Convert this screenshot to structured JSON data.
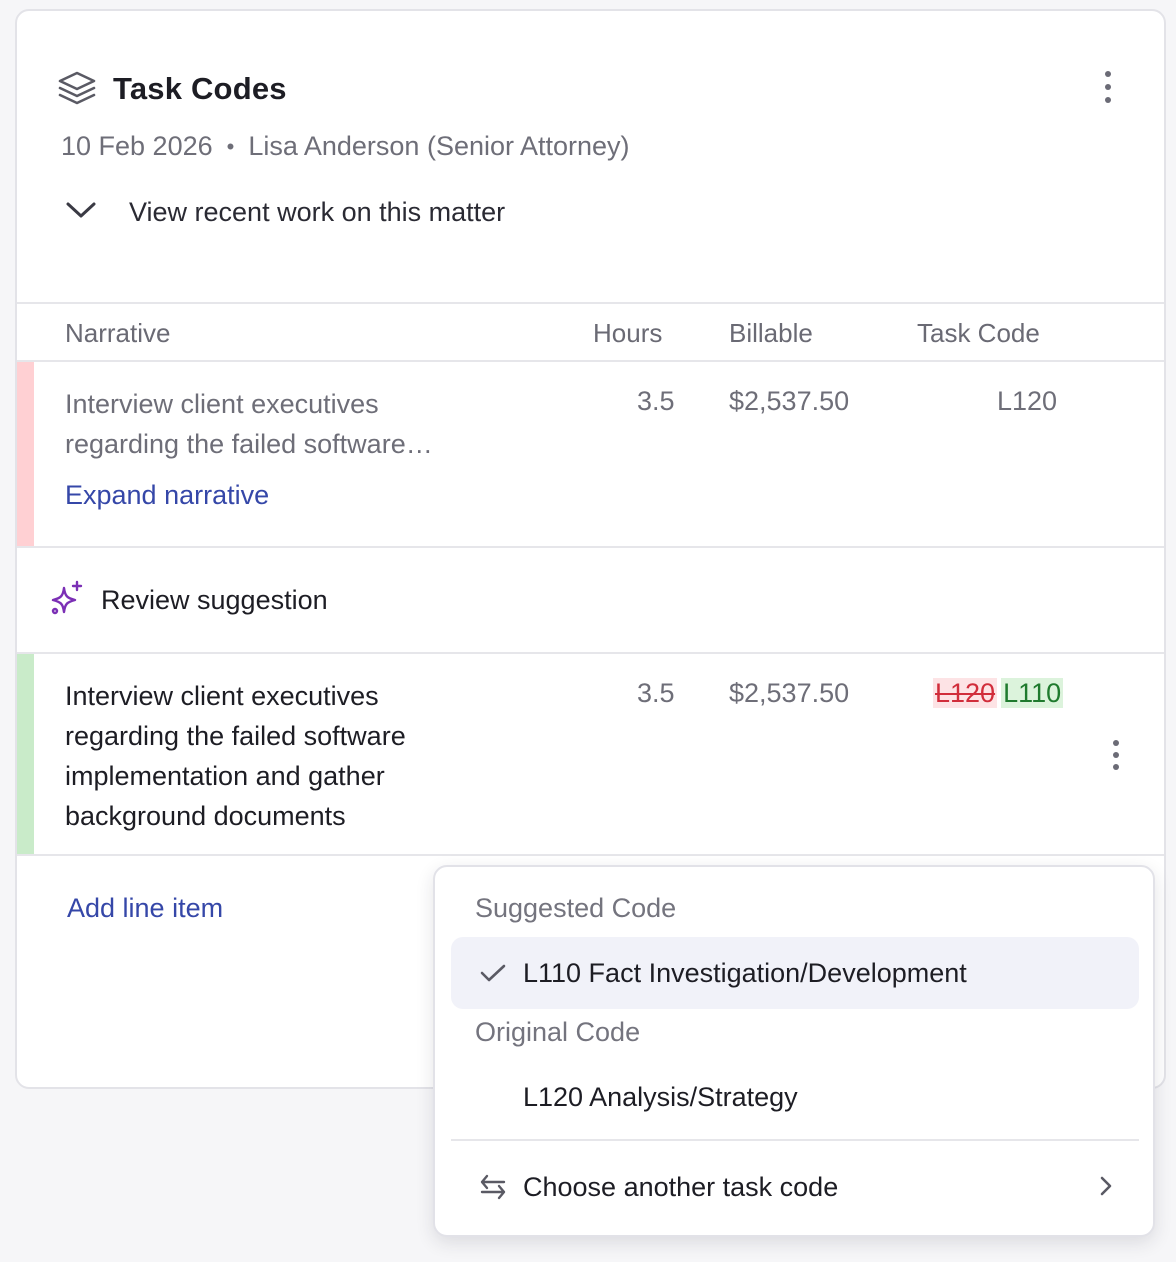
{
  "card": {
    "title": "Task Codes",
    "title_icon": "layers-icon",
    "date": "10 Feb 2026",
    "separator": "•",
    "user": "Lisa Anderson (Senior Attorney)",
    "recent_toggle": "View recent work on this matter"
  },
  "table": {
    "headers": {
      "narrative": "Narrative",
      "hours": "Hours",
      "billable": "Billable",
      "task_code": "Task Code"
    },
    "original_row": {
      "narrative": "Interview client executives regarding the failed software…",
      "hours": "3.5",
      "billable": "$2,537.50",
      "task_code": "L120",
      "expand_link": "Expand narrative",
      "accent_color": "#ffd0d3"
    },
    "review": {
      "label": "Review suggestion",
      "icon": "sparkle-icon",
      "icon_color": "#7b2fb5"
    },
    "suggested_row": {
      "narrative": "Interview client executives regarding the failed software implementation and gather background documents",
      "hours": "3.5",
      "billable": "$2,537.50",
      "old_code": "L120",
      "new_code": "L110",
      "accent_color": "#c9ebc9"
    },
    "add_line": "Add line item"
  },
  "menu": {
    "suggested_heading": "Suggested Code",
    "suggested_item": "L110 Fact Investigation/Development",
    "original_heading": "Original Code",
    "original_item": "L120 Analysis/Strategy",
    "choose_other": "Choose another task code"
  },
  "colors": {
    "link": "#3547a8",
    "strike_red": "#d12d3b",
    "new_green": "#1f7a2e"
  }
}
